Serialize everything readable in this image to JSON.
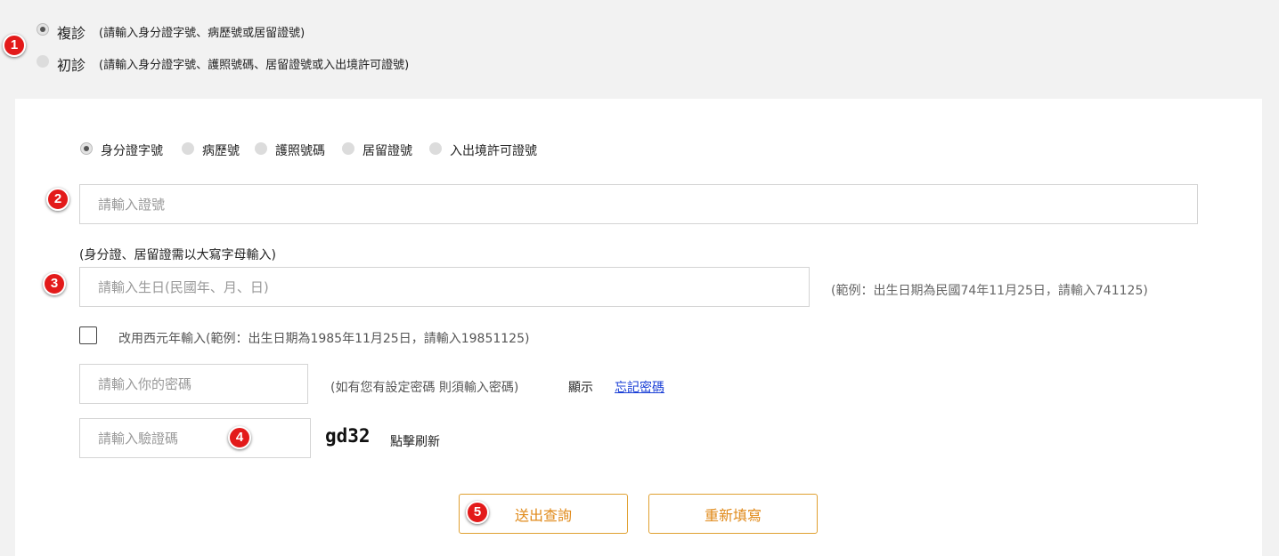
{
  "visit_type": {
    "return_label": "複診",
    "return_hint": "(請輸入身分證字號、病歷號或居留證號)",
    "first_label": "初診",
    "first_hint": "(請輸入身分證字號、護照號碼、居留證號或入出境許可證號)"
  },
  "id_types": [
    "身分證字號",
    "病歷號",
    "護照號碼",
    "居留證號",
    "入出境許可證號"
  ],
  "id_input": {
    "placeholder": "請輸入證號",
    "note": "(身分證、居留證需以大寫字母輸入)"
  },
  "birth_input": {
    "placeholder": "請輸入生日(民國年、月、日)",
    "example": "(範例：出生日期為民國74年11月25日，請輸入741125)"
  },
  "ad_year_checkbox": {
    "label": "改用西元年輸入(範例：出生日期為1985年11月25日，請輸入19851125)",
    "checked": false
  },
  "password": {
    "placeholder": "請輸入你的密碼",
    "hint": "(如有您有設定密碼 則須輸入密碼)",
    "show_label": "顯示",
    "forgot_label": "忘記密碼"
  },
  "captcha": {
    "placeholder": "請輸入驗證碼",
    "code": "gd32",
    "refresh_label": "點擊刷新"
  },
  "buttons": {
    "submit": "送出查詢",
    "reset": "重新填寫"
  },
  "badges": [
    "1",
    "2",
    "3",
    "4",
    "5"
  ],
  "colors": {
    "accent": "#e08a1a",
    "badge": "#e31a1a",
    "link": "#1a3fd6"
  }
}
